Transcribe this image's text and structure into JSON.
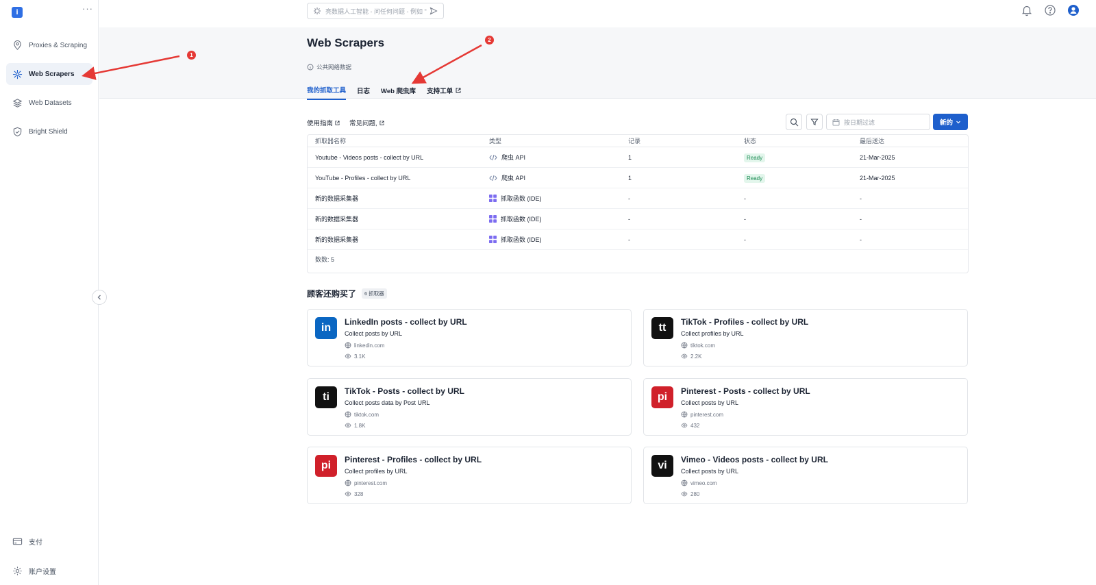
{
  "sidebar": {
    "logo": "i",
    "more": "···",
    "items": [
      {
        "label": "Proxies & Scraping",
        "icon": "location-pin-icon"
      },
      {
        "label": "Web Scrapers",
        "icon": "scraper-icon"
      },
      {
        "label": "Web Datasets",
        "icon": "layers-icon"
      },
      {
        "label": "Bright Shield",
        "icon": "shield-icon"
      }
    ],
    "bottom": [
      {
        "label": "支付",
        "icon": "card-icon"
      },
      {
        "label": "账户设置",
        "icon": "gear-icon"
      }
    ]
  },
  "topbar": {
    "ai_placeholder": "亮数据人工智能 - 问任何问题 - 例如 \"",
    "icons": [
      "bell-icon",
      "help-icon",
      "user-avatar-icon"
    ]
  },
  "header": {
    "title": "Web Scrapers",
    "subtitle": "公共网络数据",
    "tabs": [
      {
        "label": "我的抓取工具",
        "active": true
      },
      {
        "label": "日志"
      },
      {
        "label": "Web 爬虫库"
      },
      {
        "label": "支持工单",
        "external": true
      }
    ]
  },
  "toolbar": {
    "guide": "使用指南",
    "faq": "常见问题,",
    "date_placeholder": "按日期过滤",
    "new_label": "新的"
  },
  "table": {
    "headers": [
      "抓取器名称",
      "类型",
      "记录",
      "状态",
      "最后送达"
    ],
    "rows": [
      {
        "name": "Youtube - Videos posts - collect by URL",
        "type": "爬虫 API",
        "type_icon": "code-icon",
        "records": "1",
        "status": "Ready",
        "last": "21-Mar-2025"
      },
      {
        "name": "YouTube - Profiles - collect by URL",
        "type": "爬虫 API",
        "type_icon": "code-icon",
        "records": "1",
        "status": "Ready",
        "last": "21-Mar-2025"
      },
      {
        "name": "新的数据采集器",
        "type": "抓取函数 (IDE)",
        "type_icon": "grid-icon",
        "records": "-",
        "status": "-",
        "last": "-"
      },
      {
        "name": "新的数据采集器",
        "type": "抓取函数 (IDE)",
        "type_icon": "grid-icon",
        "records": "-",
        "status": "-",
        "last": "-"
      },
      {
        "name": "新的数据采集器",
        "type": "抓取函数 (IDE)",
        "type_icon": "grid-icon",
        "records": "-",
        "status": "-",
        "last": "-"
      }
    ],
    "count": "数数: 5"
  },
  "recommendations": {
    "title": "顾客还购买了",
    "badge": "6 抓取器",
    "cards": [
      {
        "logo": "in",
        "color": "#0a66c2",
        "title": "LinkedIn posts - collect by URL",
        "desc": "Collect posts by URL",
        "domain": "linkedin.com",
        "views": "3.1K"
      },
      {
        "logo": "tt",
        "color": "#111111",
        "title": "TikTok - Profiles - collect by URL",
        "desc": "Collect profiles by URL",
        "domain": "tiktok.com",
        "views": "2.2K"
      },
      {
        "logo": "ti",
        "color": "#111111",
        "title": "TikTok - Posts - collect by URL",
        "desc": "Collect posts data by Post URL",
        "domain": "tiktok.com",
        "views": "1.8K"
      },
      {
        "logo": "pi",
        "color": "#d0202a",
        "title": "Pinterest - Posts - collect by URL",
        "desc": "Collect posts by URL",
        "domain": "pinterest.com",
        "views": "432"
      },
      {
        "logo": "pi",
        "color": "#d0202a",
        "title": "Pinterest - Profiles - collect by URL",
        "desc": "Collect profiles by URL",
        "domain": "pinterest.com",
        "views": "328"
      },
      {
        "logo": "vi",
        "color": "#111111",
        "title": "Vimeo - Videos posts - collect by URL",
        "desc": "Collect posts by URL",
        "domain": "vimeo.com",
        "views": "280"
      }
    ]
  },
  "annotations": {
    "marker1": "1",
    "marker2": "2"
  },
  "colors": {
    "accent": "#1e5fcc",
    "ready": "#1a8a52",
    "arrow": "#e53935"
  }
}
